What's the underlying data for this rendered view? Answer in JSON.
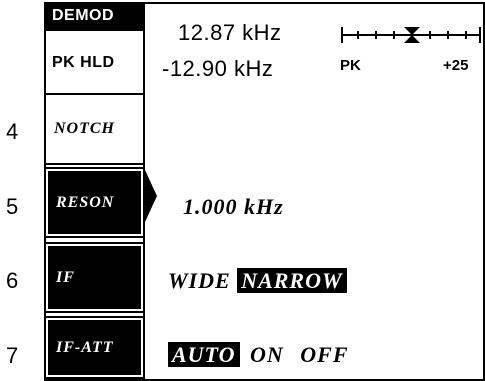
{
  "status": {
    "demod_label": "DEMOD",
    "pk_hld_label": "PK HLD"
  },
  "readout": {
    "line1": "12.87 kHz",
    "line2": "-12.90 kHz"
  },
  "meter": {
    "left_label": "PK",
    "right_label": "+25"
  },
  "softkeys": [
    {
      "number": "4",
      "label": "NOTCH"
    },
    {
      "number": "5",
      "label": "RESON"
    },
    {
      "number": "6",
      "label": "IF"
    },
    {
      "number": "7",
      "label": "IF-ATT"
    }
  ],
  "reson": {
    "value": "1.000 kHz"
  },
  "if_bw": {
    "options": [
      "WIDE",
      "NARROW"
    ],
    "selected": "NARROW"
  },
  "if_att": {
    "options": [
      "AUTO",
      "ON",
      "OFF"
    ],
    "selected": "AUTO"
  }
}
